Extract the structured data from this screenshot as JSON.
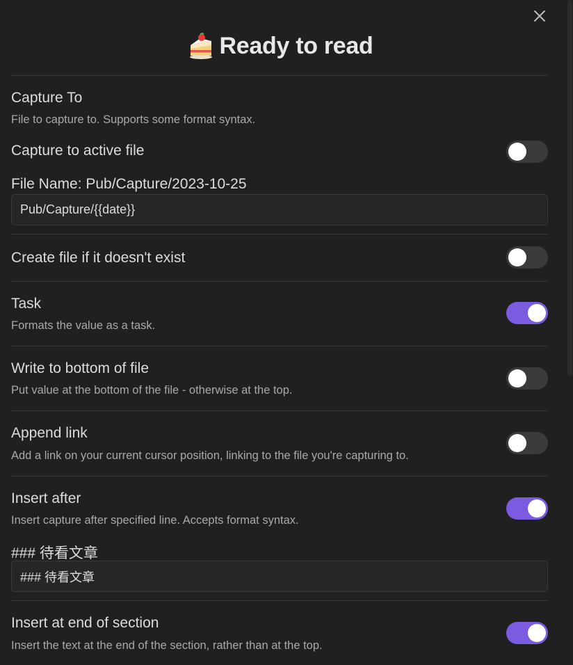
{
  "modal": {
    "title": "Ready to read",
    "title_icon": "cake-emoji-icon",
    "close_icon": "close-icon"
  },
  "colors": {
    "accent": "#7b5ce0",
    "background": "#202020",
    "toggle_off": "#3b3b3b"
  },
  "capture_to": {
    "label": "Capture To",
    "desc": "File to capture to. Supports some format syntax."
  },
  "active_file": {
    "label": "Capture to active file",
    "enabled": false
  },
  "file_name": {
    "label": "File Name: Pub/Capture/2023-10-25",
    "value": "Pub/Capture/{{date}}"
  },
  "create_file": {
    "label": "Create file if it doesn't exist",
    "enabled": false
  },
  "task": {
    "label": "Task",
    "desc": "Formats the value as a task.",
    "enabled": true
  },
  "write_bottom": {
    "label": "Write to bottom of file",
    "desc": "Put value at the bottom of the file - otherwise at the top.",
    "enabled": false
  },
  "append_link": {
    "label": "Append link",
    "desc": "Add a link on your current cursor position, linking to the file you're capturing to.",
    "enabled": false
  },
  "insert_after": {
    "label": "Insert after",
    "desc": "Insert capture after specified line. Accepts format syntax.",
    "enabled": true,
    "preview": "### 待看文章",
    "value": "### 待看文章"
  },
  "insert_end": {
    "label": "Insert at end of section",
    "desc": "Insert the text at the end of the section, rather than at the top.",
    "enabled": true
  }
}
